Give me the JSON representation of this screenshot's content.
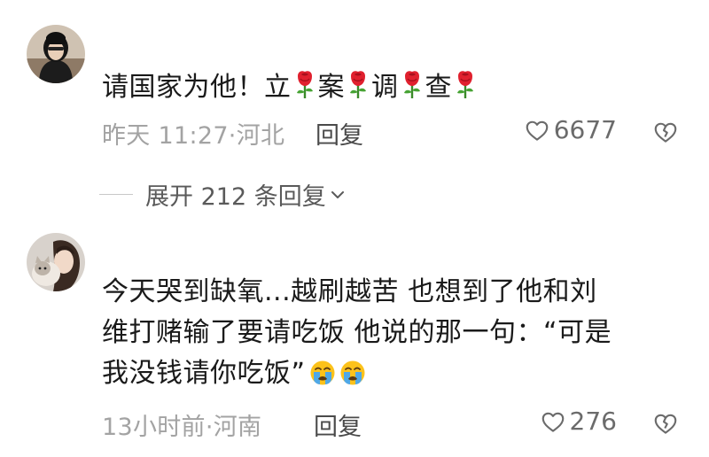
{
  "comments": [
    {
      "segments": [
        "请国家为他！立",
        "案",
        "调",
        "查"
      ],
      "time": "昨天 11:27",
      "location": "河北",
      "reply_label": "回复",
      "likes": "6677"
    },
    {
      "lines": [
        "今天哭到缺氧...越刷越苦 也想到了他和刘",
        "维打赌输了要请吃饭 他说的那一句：“可是",
        "我没钱请你吃饭”"
      ],
      "time": "13小时前",
      "location": "河南",
      "reply_label": "回复",
      "likes": "276"
    }
  ],
  "expand_replies": "展开 212 条回复",
  "separator": "·",
  "icons": {
    "like": "heart-outline-icon",
    "dislike": "broken-heart-icon",
    "expand": "chevron-down-icon",
    "rose": "rose-emoji",
    "crying": "loudly-crying-face-emoji"
  },
  "colors": {
    "text": "#1a1a1a",
    "meta": "#a3a3a3",
    "reply": "#4a4a4a",
    "rose": "#e0202e"
  }
}
